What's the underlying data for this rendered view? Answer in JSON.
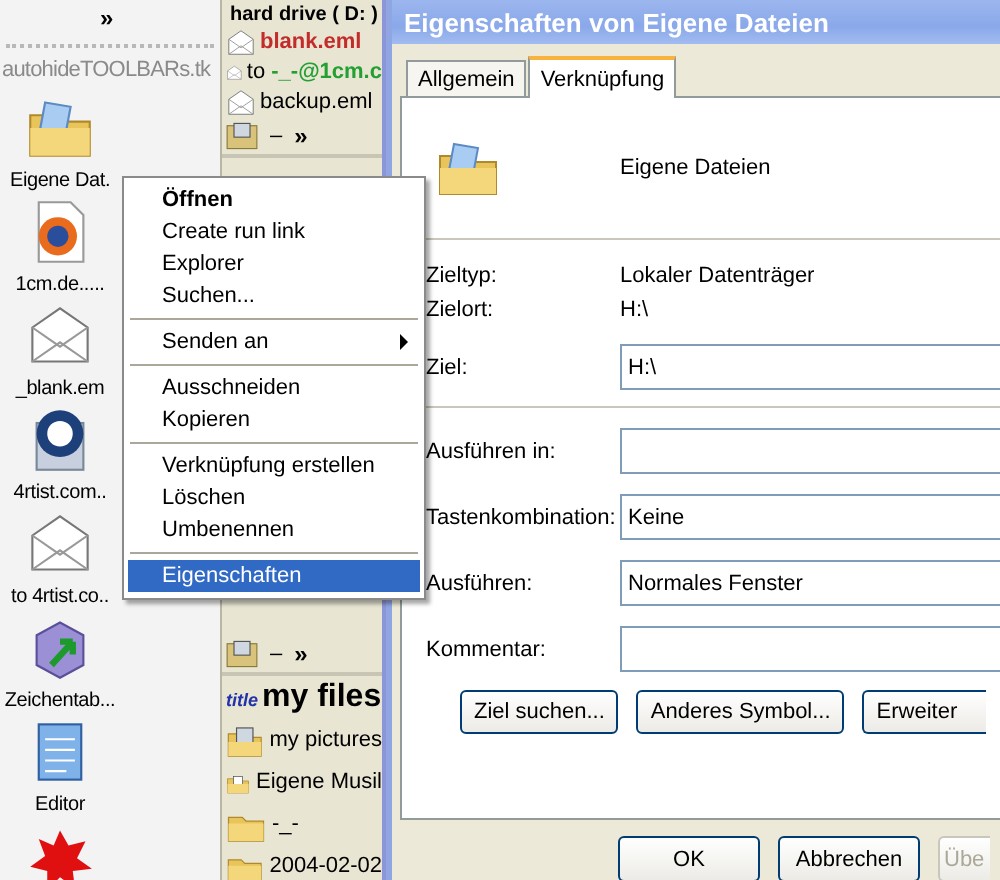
{
  "desktop": {
    "chevron": "»",
    "toolbar_label": "autohideTOOLBARs.tk",
    "icons": [
      {
        "label": "Eigene Dat.",
        "kind": "folder"
      },
      {
        "label": "1cm.de.....",
        "kind": "browser"
      },
      {
        "label": "_blank.em",
        "kind": "mail"
      },
      {
        "label": "4rtist.com..",
        "kind": "app"
      },
      {
        "label": "to 4rtist.co..",
        "kind": "mail"
      },
      {
        "label": "Zeichentab...",
        "kind": "cube"
      },
      {
        "label": "Editor",
        "kind": "notepad"
      },
      {
        "kind": "splat"
      }
    ]
  },
  "quick_panel": {
    "title": "hard drive ( D: )",
    "items": [
      {
        "text": "**blank.eml**",
        "color": "#c42b2b",
        "kind": "mail"
      },
      {
        "text": "to **-_-@1cm.c**",
        "color": "#22a032",
        "kind": "mail"
      },
      {
        "text": "backup.eml",
        "kind": "mail"
      }
    ],
    "more": {
      "text": "–",
      "chevron": "»"
    },
    "lower_more": {
      "text": "–",
      "chevron": "»"
    },
    "section": {
      "tag": "title",
      "title": "my files",
      "items": [
        {
          "text": "my pictures",
          "kind": "pictures"
        },
        {
          "text": "Eigene Musil",
          "kind": "music"
        },
        {
          "text": "-_-",
          "kind": "folder"
        },
        {
          "text": "2004-02-02",
          "kind": "folder"
        }
      ]
    }
  },
  "context_menu": [
    {
      "kind": "item",
      "label": "Öffnen",
      "default": true,
      "selected": false
    },
    {
      "kind": "item",
      "label": "Create run link",
      "default": false,
      "selected": false
    },
    {
      "kind": "item",
      "label": "Explorer",
      "default": false,
      "selected": false
    },
    {
      "kind": "item",
      "label": "Suchen...",
      "default": false,
      "selected": false
    },
    {
      "kind": "separator"
    },
    {
      "kind": "submenu",
      "label": "Senden an",
      "default": false,
      "selected": false
    },
    {
      "kind": "separator"
    },
    {
      "kind": "item",
      "label": "Ausschneiden",
      "default": false,
      "selected": false
    },
    {
      "kind": "item",
      "label": "Kopieren",
      "default": false,
      "selected": false
    },
    {
      "kind": "separator"
    },
    {
      "kind": "item",
      "label": "Verknüpfung erstellen",
      "default": false,
      "selected": false
    },
    {
      "kind": "item",
      "label": "Löschen",
      "default": false,
      "selected": false
    },
    {
      "kind": "item",
      "label": "Umbenennen",
      "default": false,
      "selected": false
    },
    {
      "kind": "separator"
    },
    {
      "kind": "item",
      "label": "Eigenschaften",
      "default": false,
      "selected": true
    }
  ],
  "dialog": {
    "title": "Eigenschaften von Eigene Dateien",
    "tabs": [
      {
        "label": "Allgemein",
        "selected": false
      },
      {
        "label": "Verknüpfung",
        "selected": true
      }
    ],
    "name": "Eigene Dateien",
    "info": [
      {
        "label": "Zieltyp:",
        "value": "Lokaler Datenträger"
      },
      {
        "label": "Zielort:",
        "value": "H:\\"
      }
    ],
    "target": {
      "label": "Ziel:",
      "value": "H:\\"
    },
    "fields": [
      {
        "label": "Ausführen in:"
      },
      {
        "label": "Tastenkombination:",
        "value": "Keine"
      },
      {
        "label": "Ausführen:",
        "value": "Normales Fenster"
      },
      {
        "label": "Kommentar:"
      }
    ],
    "actions": [
      "Ziel suchen...",
      "Anderes Symbol...",
      "Erweiter"
    ],
    "buttons": [
      {
        "label": "OK",
        "disabled": false
      },
      {
        "label": "Abbrechen",
        "disabled": false
      },
      {
        "label": "Übe",
        "disabled": true
      }
    ]
  }
}
